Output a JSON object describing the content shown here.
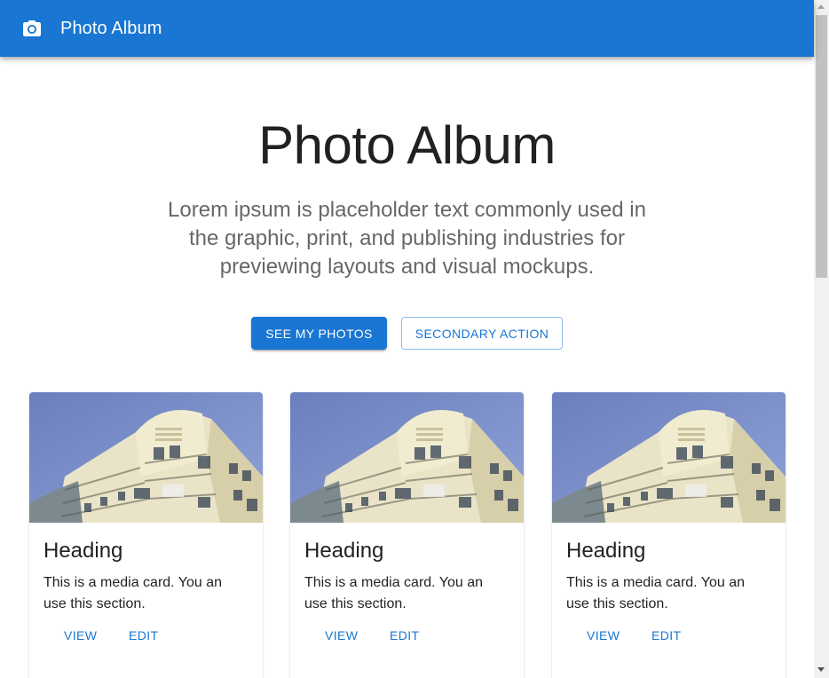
{
  "appbar": {
    "icon": "camera-icon",
    "title": "Photo Album",
    "background_color": "#1976d2"
  },
  "hero": {
    "title": "Photo Album",
    "description": "Lorem ipsum is placeholder text commonly used in the graphic, print, and publishing industries for previewing layouts and visual mockups.",
    "primary_button": "See my photos",
    "secondary_button": "Secondary action"
  },
  "cards": [
    {
      "image": "building-photo",
      "heading": "Heading",
      "body": "This is a media card. You an use this section.",
      "actions": {
        "view": "View",
        "edit": "Edit"
      }
    },
    {
      "image": "building-photo",
      "heading": "Heading",
      "body": "This is a media card. You an use this section.",
      "actions": {
        "view": "View",
        "edit": "Edit"
      }
    },
    {
      "image": "building-photo",
      "heading": "Heading",
      "body": "This is a media card. You an use this section.",
      "actions": {
        "view": "View",
        "edit": "Edit"
      }
    }
  ],
  "colors": {
    "primary": "#1976d2",
    "text_primary": "rgba(0,0,0,0.87)",
    "text_secondary": "rgba(0,0,0,0.6)"
  }
}
